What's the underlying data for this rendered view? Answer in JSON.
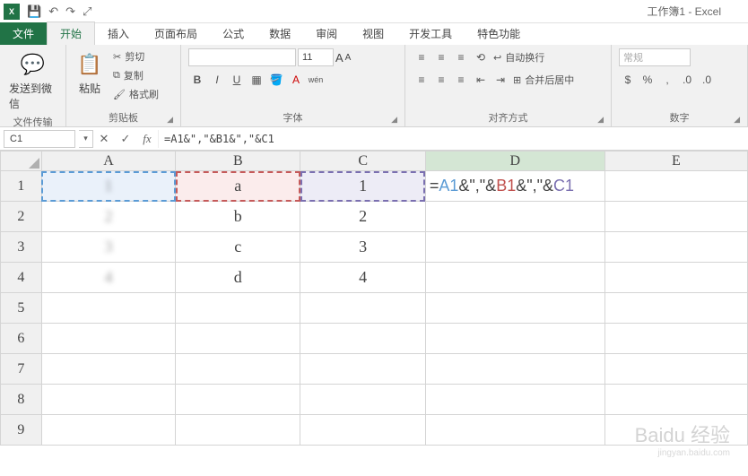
{
  "app": {
    "title": "工作簿1 - Excel",
    "logo": "X"
  },
  "qat": {
    "save": "💾",
    "undo": "↶",
    "redo": "↷",
    "touch": "⤢"
  },
  "tabs": {
    "file": "文件",
    "home": "开始",
    "insert": "插入",
    "layout": "页面布局",
    "formulas": "公式",
    "data": "数据",
    "review": "审阅",
    "view": "视图",
    "dev": "开发工具",
    "special": "特色功能"
  },
  "ribbon": {
    "wechat": {
      "label": "发送到微信",
      "group": "文件传输"
    },
    "clipboard": {
      "paste": "粘贴",
      "cut": "剪切",
      "copy": "复制",
      "format_painter": "格式刷",
      "group": "剪贴板"
    },
    "font": {
      "size": "11",
      "bold": "B",
      "italic": "I",
      "underline": "U",
      "group": "字体",
      "wen": "wén",
      "aa_big": "A",
      "aa_small": "A"
    },
    "align": {
      "wrap": "自动换行",
      "merge": "合并后居中",
      "group": "对齐方式"
    },
    "number": {
      "general": "常规",
      "group": "数字"
    }
  },
  "formula_bar": {
    "name_box": "C1",
    "cancel": "✕",
    "enter": "✓",
    "fx": "fx",
    "formula": "=A1&\",\"&B1&\",\"&C1"
  },
  "grid": {
    "cols": [
      "A",
      "B",
      "C",
      "D",
      "E"
    ],
    "rows": [
      {
        "n": "1",
        "A": "1",
        "B": "a",
        "C": "1"
      },
      {
        "n": "2",
        "A": "2",
        "B": "b",
        "C": "2"
      },
      {
        "n": "3",
        "A": "3",
        "B": "c",
        "C": "3"
      },
      {
        "n": "4",
        "A": "4",
        "B": "d",
        "C": "4"
      },
      {
        "n": "5"
      },
      {
        "n": "6"
      },
      {
        "n": "7"
      },
      {
        "n": "8"
      },
      {
        "n": "9"
      }
    ],
    "editing": {
      "eq": "=",
      "a1": "A1",
      "amp1": "&\",\"&",
      "b1": "B1",
      "amp2": "&\",\"&",
      "c1": "C1"
    }
  },
  "watermark": {
    "main": "Baidu 经验",
    "sub": "jingyan.baidu.com"
  }
}
